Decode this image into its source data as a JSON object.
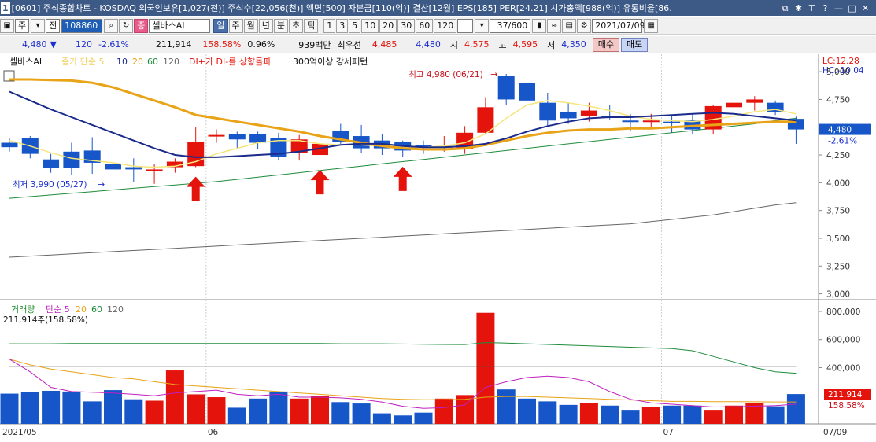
{
  "window": {
    "number": "1",
    "title": "[0601] 주식종합차트 - KOSDAQ 외국인보유[1,027(천)] 주식수[22,056(천)] 액면[500] 자본금[110(억)] 결산[12월] EPS[185] PER[24.21] 시가총액[988(억)] 유통비율[86."
  },
  "toolbar": {
    "market_select": "주",
    "mode_select": "전",
    "code": "108860",
    "badge": "증",
    "name": "셀바스AI",
    "periods": [
      "일",
      "주",
      "월",
      "년",
      "분",
      "초",
      "틱"
    ],
    "active_period": "일",
    "intervals": [
      "1",
      "3",
      "5",
      "10",
      "20",
      "30",
      "60",
      "120"
    ],
    "count": "37/600",
    "date": "2021/07/09"
  },
  "quote": {
    "price": "4,480",
    "arrow": "▼",
    "change": "120",
    "rate": "-2.61%",
    "volume": "211,914",
    "vol_ratio": "158.58%",
    "turnover": "0.96%",
    "amount": "939백만",
    "best_label": "최우선",
    "best_ask": "4,485",
    "best_bid": "4,480",
    "open_label": "시",
    "open": "4,575",
    "high_label": "고",
    "high": "4,595",
    "low_label": "저",
    "low": "4,350",
    "buy": "매수",
    "sell": "매도"
  },
  "legend": {
    "name": "셀바스AI",
    "ma_label": "종가 단순 5",
    "ma_periods": [
      "10",
      "20",
      "60",
      "120"
    ],
    "signal1": "DI+가 DI-를 상향돌파",
    "signal2": "300억이상 강세패턴",
    "lc": "LC:12.28",
    "hc": "HC:-10.04"
  },
  "colors": {
    "up": "#e4140d",
    "down": "#1656c8",
    "ma5": "#f5e67a",
    "ma10": "#1a2b8c",
    "ma20": "#e8a317",
    "ma60": "#1e8c3c",
    "ma120": "#666666",
    "signal_arrow": "#e4140d"
  },
  "chart_data": {
    "type": "candlestick",
    "dates": [
      "05/17",
      "05/18",
      "05/20",
      "05/21",
      "05/24",
      "05/25",
      "05/26",
      "05/27",
      "05/28",
      "05/31",
      "06/01",
      "06/02",
      "06/03",
      "06/04",
      "06/07",
      "06/08",
      "06/09",
      "06/10",
      "06/11",
      "06/14",
      "06/15",
      "06/16",
      "06/17",
      "06/18",
      "06/21",
      "06/22",
      "06/23",
      "06/24",
      "06/25",
      "06/28",
      "06/29",
      "06/30",
      "07/01",
      "07/02",
      "07/05",
      "07/06",
      "07/07",
      "07/08",
      "07/09"
    ],
    "open": [
      4360,
      4400,
      4210,
      4280,
      4290,
      4170,
      4140,
      4110,
      4140,
      4150,
      4420,
      4440,
      4440,
      4400,
      4270,
      4250,
      4470,
      4420,
      4380,
      4370,
      4340,
      4330,
      4300,
      4450,
      4960,
      4900,
      4720,
      4640,
      4600,
      4600,
      4560,
      4550,
      4550,
      4560,
      4480,
      4680,
      4720,
      4720,
      4575
    ],
    "close": [
      4320,
      4260,
      4130,
      4130,
      4180,
      4120,
      4120,
      4120,
      4190,
      4370,
      4430,
      4390,
      4360,
      4230,
      4390,
      4350,
      4370,
      4310,
      4310,
      4290,
      4320,
      4330,
      4450,
      4680,
      4750,
      4740,
      4560,
      4580,
      4650,
      4590,
      4550,
      4560,
      4540,
      4480,
      4690,
      4720,
      4750,
      4640,
      4480
    ],
    "high": [
      4400,
      4420,
      4260,
      4360,
      4410,
      4260,
      4220,
      4170,
      4220,
      4500,
      4480,
      4460,
      4460,
      4450,
      4430,
      4360,
      4530,
      4520,
      4440,
      4380,
      4380,
      4420,
      4510,
      4770,
      4980,
      4920,
      4810,
      4720,
      4720,
      4700,
      4620,
      4620,
      4600,
      4620,
      4700,
      4760,
      4780,
      4740,
      4595
    ],
    "low": [
      4280,
      4220,
      4090,
      4070,
      4080,
      4050,
      4010,
      3990,
      4090,
      4140,
      4360,
      4300,
      4300,
      4200,
      4200,
      4200,
      4350,
      4270,
      4250,
      4230,
      4260,
      4280,
      4260,
      4440,
      4700,
      4700,
      4500,
      4530,
      4550,
      4570,
      4470,
      4480,
      4450,
      4440,
      4440,
      4640,
      4650,
      4610,
      4350
    ],
    "ma5": [
      4380,
      4330,
      4270,
      4220,
      4200,
      4180,
      4150,
      4140,
      4150,
      4190,
      4260,
      4310,
      4360,
      4380,
      4380,
      4350,
      4340,
      4340,
      4330,
      4320,
      4320,
      4330,
      4360,
      4440,
      4580,
      4700,
      4740,
      4720,
      4690,
      4650,
      4600,
      4570,
      4560,
      4550,
      4570,
      4600,
      4640,
      4660,
      4620
    ],
    "ma10": [
      4820,
      4740,
      4660,
      4590,
      4520,
      4450,
      4380,
      4310,
      4250,
      4230,
      4230,
      4240,
      4250,
      4260,
      4280,
      4310,
      4340,
      4350,
      4350,
      4330,
      4320,
      4320,
      4330,
      4350,
      4400,
      4460,
      4510,
      4550,
      4580,
      4590,
      4590,
      4600,
      4610,
      4620,
      4630,
      4620,
      4600,
      4580,
      4560
    ],
    "ma20": [
      4930,
      4930,
      4925,
      4920,
      4900,
      4860,
      4800,
      4740,
      4680,
      4610,
      4580,
      4550,
      4520,
      4490,
      4460,
      4420,
      4390,
      4360,
      4330,
      4310,
      4300,
      4300,
      4310,
      4340,
      4380,
      4420,
      4450,
      4470,
      4480,
      4480,
      4490,
      4490,
      4500,
      4510,
      4520,
      4530,
      4540,
      4550,
      4550
    ],
    "ma60": [
      3860,
      3875,
      3890,
      3905,
      3920,
      3935,
      3950,
      3965,
      3980,
      3995,
      4010,
      4030,
      4050,
      4070,
      4090,
      4110,
      4130,
      4150,
      4170,
      4190,
      4210,
      4230,
      4250,
      4270,
      4290,
      4310,
      4330,
      4350,
      4370,
      4390,
      4410,
      4430,
      4450,
      4470,
      4490,
      4510,
      4530,
      4560,
      4580
    ],
    "ma120": [
      3330,
      3340,
      3350,
      3360,
      3370,
      3380,
      3390,
      3400,
      3410,
      3420,
      3430,
      3440,
      3450,
      3460,
      3470,
      3480,
      3490,
      3500,
      3510,
      3520,
      3530,
      3540,
      3550,
      3560,
      3570,
      3580,
      3590,
      3600,
      3610,
      3620,
      3630,
      3650,
      3670,
      3690,
      3710,
      3740,
      3770,
      3800,
      3820
    ],
    "signals": [
      "05/31",
      "06/08",
      "06/14"
    ],
    "y_ticks": [
      "5,000",
      "4,750",
      "4,500",
      "4,250",
      "4,000",
      "3,750",
      "3,500",
      "3,250",
      "3,000"
    ],
    "ylim": [
      2990,
      5100
    ],
    "last_price_label": "4,480",
    "last_rate_label": "-2.61%",
    "annot_high": "최고 4,980 (06/21)",
    "annot_low": "최저 3,990 (05/27)",
    "volume": {
      "legend": [
        "거래량",
        "단순 5",
        "20",
        "60",
        "120"
      ],
      "readout": "211,914주(158.58%)",
      "values": [
        215000,
        225000,
        235000,
        230000,
        160000,
        240000,
        175000,
        165000,
        380000,
        210000,
        190000,
        115000,
        180000,
        230000,
        180000,
        200000,
        155000,
        145000,
        75000,
        60000,
        80000,
        180000,
        205000,
        790000,
        245000,
        180000,
        160000,
        135000,
        150000,
        130000,
        100000,
        120000,
        130000,
        130000,
        100000,
        130000,
        150000,
        125000,
        211914
      ],
      "ma5": [
        460000,
        370000,
        260000,
        230000,
        225000,
        220000,
        210000,
        200000,
        220000,
        230000,
        240000,
        210000,
        200000,
        210000,
        190000,
        190000,
        185000,
        175000,
        155000,
        125000,
        110000,
        115000,
        135000,
        260000,
        300000,
        330000,
        340000,
        330000,
        300000,
        230000,
        175000,
        150000,
        140000,
        130000,
        120000,
        122000,
        126000,
        130000,
        140000
      ],
      "ma20": [
        460000,
        420000,
        390000,
        370000,
        350000,
        330000,
        320000,
        300000,
        280000,
        270000,
        260000,
        250000,
        240000,
        230000,
        220000,
        210000,
        200000,
        190000,
        180000,
        175000,
        172000,
        172000,
        175000,
        190000,
        195000,
        195000,
        190000,
        185000,
        180000,
        175000,
        170000,
        165000,
        160000,
        160000,
        158000,
        158000,
        157000,
        156000,
        156000
      ],
      "ma60": [
        570000,
        570000,
        570000,
        572000,
        572000,
        572000,
        572000,
        572000,
        572000,
        572000,
        572000,
        572000,
        572000,
        572000,
        572000,
        572000,
        570000,
        570000,
        570000,
        568000,
        566000,
        565000,
        564000,
        578000,
        575000,
        570000,
        565000,
        560000,
        555000,
        550000,
        545000,
        540000,
        535000,
        520000,
        480000,
        440000,
        400000,
        370000,
        360000
      ],
      "ma120": [
        410000,
        410000,
        410000,
        410000,
        410000,
        410000,
        410000,
        410000,
        410000,
        410000,
        410000,
        410000,
        410000,
        410000,
        410000,
        410000,
        410000,
        410000,
        410000,
        410000,
        410000,
        410000,
        410000,
        410000,
        410000,
        410000,
        410000,
        410000,
        410000,
        410000,
        410000,
        410000,
        410000,
        410000,
        410000,
        410000,
        410000,
        410000,
        410000
      ],
      "y_ticks": [
        "800,000",
        "600,000",
        "400,000"
      ],
      "ylim": [
        0,
        850000
      ],
      "last_label": "211,914",
      "last_rate": "158.58%"
    },
    "x_labels": [
      {
        "at": "05/17",
        "text": "2021/05"
      },
      {
        "at": "06/01",
        "text": "06"
      },
      {
        "at": "07/01",
        "text": "07"
      }
    ],
    "x_end_label": "07/09"
  }
}
